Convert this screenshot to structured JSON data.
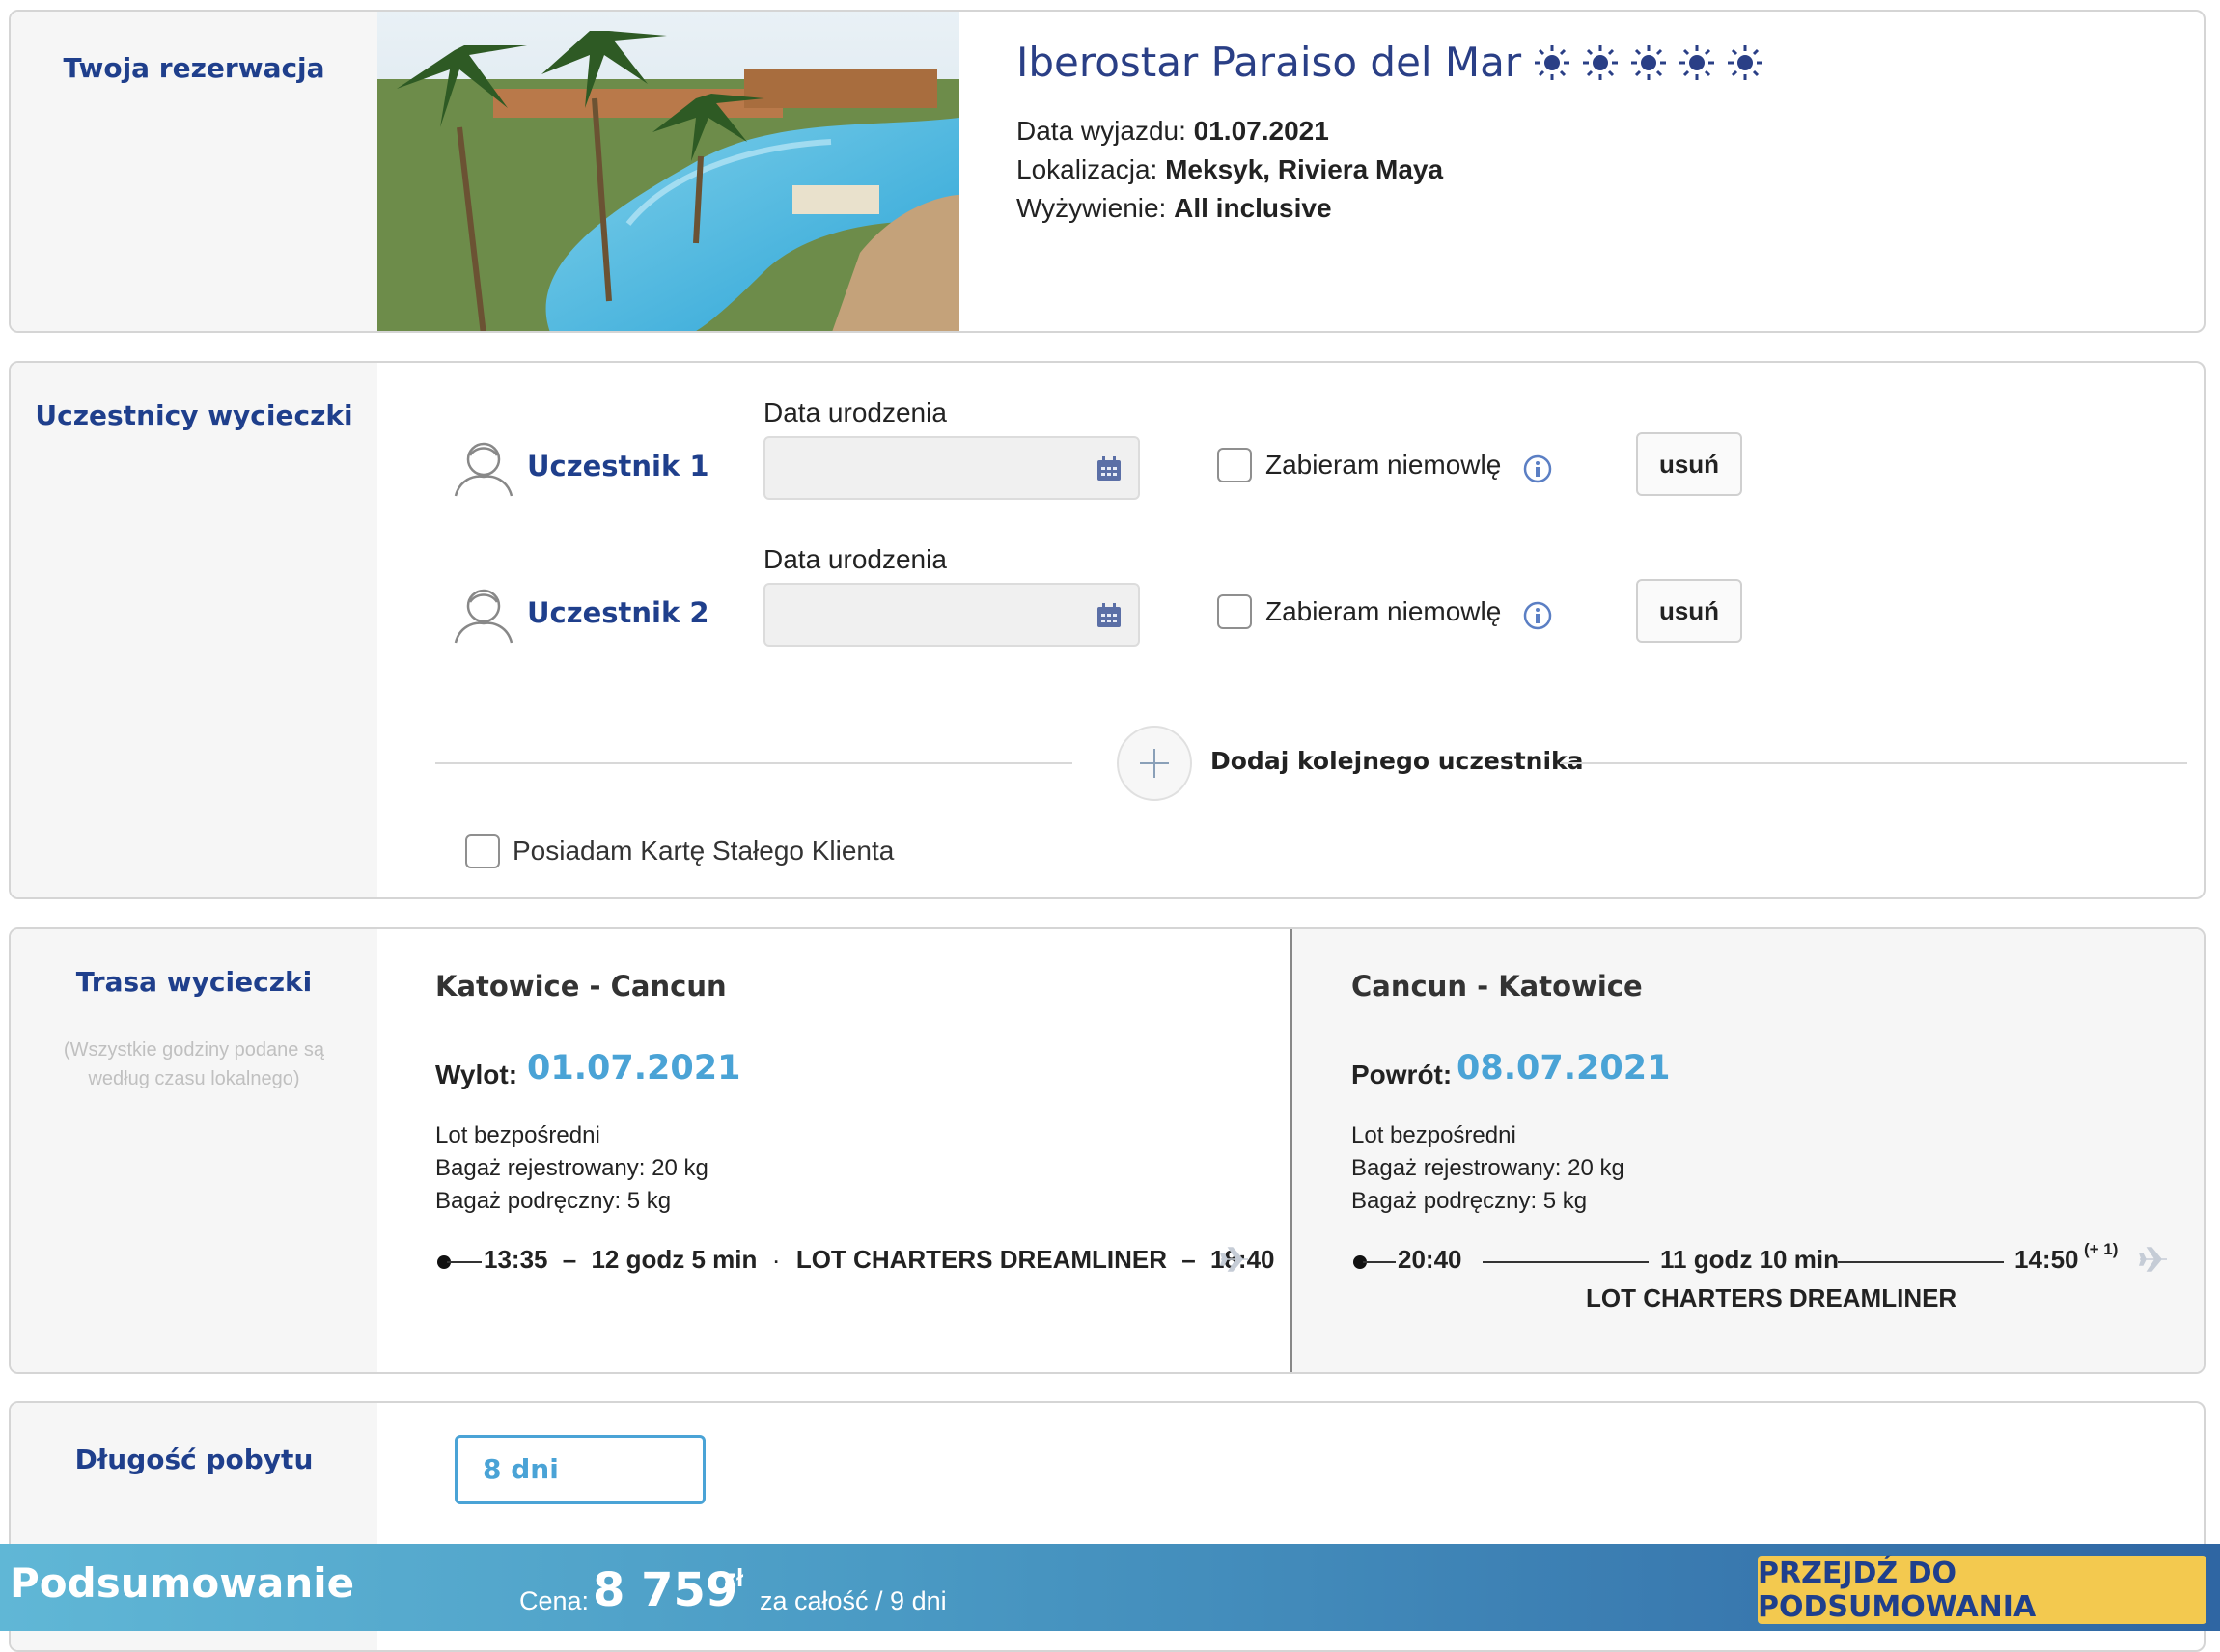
{
  "reservation": {
    "section_title": "Twoja rezerwacja",
    "hotel_name": "Iberostar Paraiso del Mar",
    "stars": 5,
    "departure_label": "Data wyjazdu:",
    "departure_value": "01.07.2021",
    "location_label": "Lokalizacja:",
    "location_value": "Meksyk, Riviera Maya",
    "board_label": "Wyżywienie:",
    "board_value": "All inclusive",
    "photo_icon": "resort-pool-photo"
  },
  "participants": {
    "section_title": "Uczestnicy wycieczki",
    "list": [
      {
        "name": "Uczestnik 1",
        "dob_label": "Data urodzenia",
        "dob_value": "",
        "infant_label": "Zabieram niemowlę",
        "infant_checked": false,
        "remove_label": "usuń"
      },
      {
        "name": "Uczestnik 2",
        "dob_label": "Data urodzenia",
        "dob_value": "",
        "infant_label": "Zabieram niemowlę",
        "infant_checked": false,
        "remove_label": "usuń"
      }
    ],
    "add_label": "Dodaj kolejnego uczestnika",
    "loyalty_label": "Posiadam Kartę Stałego Klienta",
    "loyalty_checked": false
  },
  "route": {
    "section_title": "Trasa wycieczki",
    "note": "(Wszystkie godziny podane są według czasu lokalnego)",
    "outbound": {
      "route": "Katowice - Cancun",
      "date_label": "Wylot:",
      "date_value": "01.07.2021",
      "flight_type": "Lot bezpośredni",
      "checked_baggage": "Bagaż rejestrowany: 20 kg",
      "cabin_baggage": "Bagaż podręczny: 5 kg",
      "dep_time": "13:35",
      "duration": "12 godz 5 min",
      "carrier": "LOT CHARTERS DREAMLINER",
      "arr_time": "18:40"
    },
    "inbound": {
      "route": "Cancun - Katowice",
      "date_label": "Powrót:",
      "date_value": "08.07.2021",
      "flight_type": "Lot bezpośredni",
      "checked_baggage": "Bagaż rejestrowany: 20 kg",
      "cabin_baggage": "Bagaż podręczny: 5 kg",
      "dep_time": "20:40",
      "duration": "11 godz 10 min",
      "arr_time": "14:50",
      "arr_day_offset": "(+ 1)",
      "carrier": "LOT CHARTERS DREAMLINER"
    }
  },
  "stay": {
    "section_title": "Długość pobytu",
    "selected": "8 dni"
  },
  "summary": {
    "title": "Podsumowanie",
    "price_label": "Cena:",
    "price_value": "8 759",
    "currency": "zł",
    "price_note": "za całość / 9 dni",
    "cta_label": "PRZEJDŹ DO PODSUMOWANIA"
  },
  "colors": {
    "brand_navy": "#1f3f8c",
    "accent_blue": "#4aa3d6",
    "cta_yellow": "#f3c94f"
  }
}
